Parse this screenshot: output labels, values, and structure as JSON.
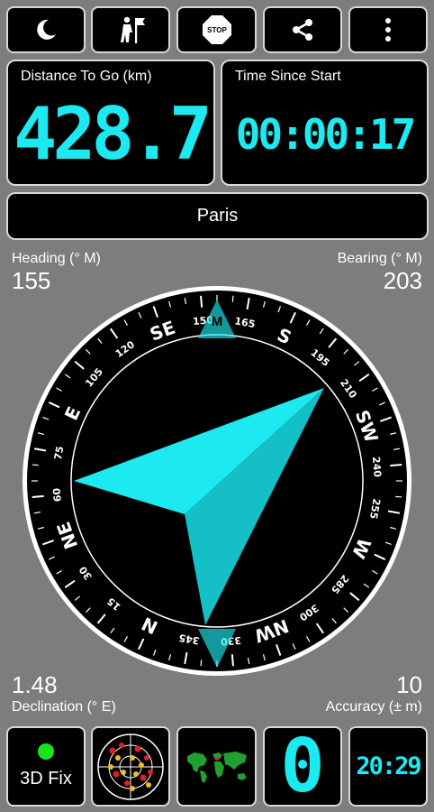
{
  "toolbar": {
    "buttons": [
      {
        "name": "night-mode",
        "icon": "moon-icon"
      },
      {
        "name": "waypoint",
        "icon": "hiker-flag-icon"
      },
      {
        "name": "stop",
        "icon": "stop-sign-icon",
        "label": "STOP"
      },
      {
        "name": "share",
        "icon": "share-icon"
      },
      {
        "name": "menu",
        "icon": "more-vert-icon"
      }
    ]
  },
  "distance": {
    "label": "Distance To Go (km)",
    "value": "428.7"
  },
  "time": {
    "label": "Time Since Start",
    "value": "00:00:17"
  },
  "destination": {
    "name": "Paris"
  },
  "heading": {
    "label": "Heading (° M)",
    "value": "155"
  },
  "bearing": {
    "label": "Bearing (° M)",
    "value": "203"
  },
  "declination": {
    "label": "Declination (° E)",
    "value": "1.48"
  },
  "accuracy": {
    "label": "Accuracy (± m)",
    "value": "10"
  },
  "compass": {
    "heading_deg": 155,
    "bearing_deg": 203,
    "cardinals": [
      "N",
      "NE",
      "E",
      "SE",
      "S",
      "SW",
      "W",
      "NW"
    ],
    "bezel_marker": "M"
  },
  "bottom": {
    "fix_label": "3D Fix",
    "fix_status_color": "#19e619",
    "satellites": "0",
    "clock": "20:29"
  },
  "colors": {
    "accent": "#1de9f0",
    "accent_dark": "#14bfc6"
  }
}
